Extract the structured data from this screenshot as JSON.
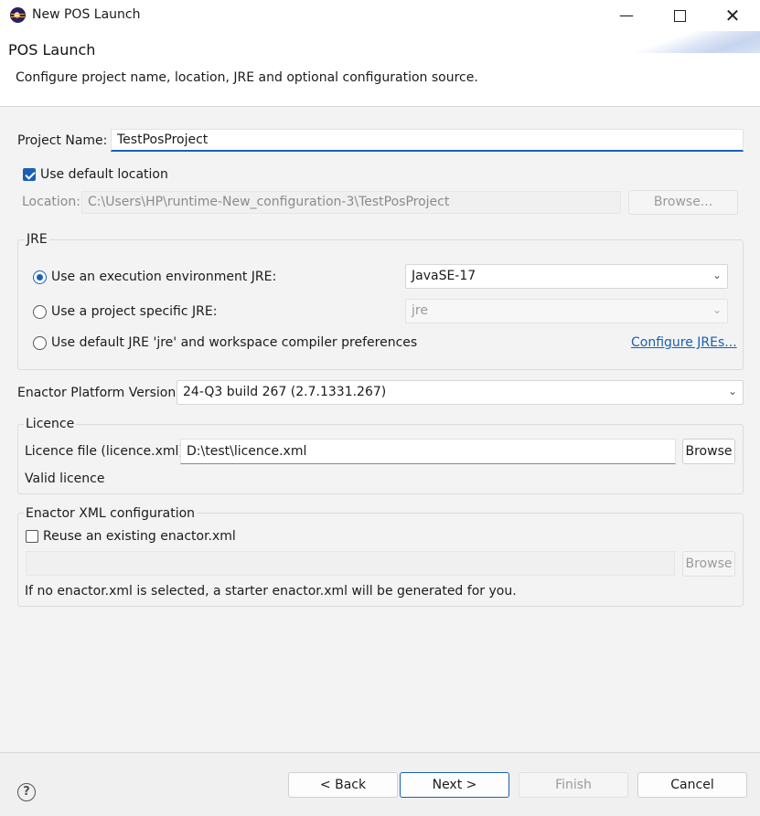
{
  "window": {
    "title": "New POS Launch",
    "minimize_icon": "minimize-icon",
    "maximize_icon": "maximize-icon",
    "close_icon": "close-icon"
  },
  "header": {
    "title": "POS Launch",
    "description": "Configure project name, location, JRE and optional configuration source."
  },
  "project": {
    "name_label": "Project Name:",
    "name_value": "TestPosProject"
  },
  "location": {
    "use_default_label": "Use default location",
    "use_default_checked": true,
    "label": "Location:",
    "value": "C:\\Users\\HP\\runtime-New_configuration-3\\TestPosProject",
    "browse_label": "Browse..."
  },
  "jre": {
    "group_title": "JRE",
    "option_env_label": "Use an execution environment JRE:",
    "option_env_value": "JavaSE-17",
    "option_specific_label": "Use a project specific JRE:",
    "option_specific_value": "jre",
    "option_default_label": "Use default JRE 'jre' and workspace compiler preferences",
    "configure_link": "Configure JREs...",
    "selected": "env"
  },
  "platform": {
    "label": "Enactor Platform Version:",
    "value": "24-Q3 build 267 (2.7.1331.267)"
  },
  "licence": {
    "group_title": "Licence",
    "file_label": "Licence file (licence.xml):",
    "file_value": "D:\\test\\licence.xml",
    "browse_label": "Browse",
    "status": "Valid licence"
  },
  "xml_config": {
    "group_title": "Enactor XML configuration",
    "reuse_label": "Reuse an existing enactor.xml",
    "reuse_checked": false,
    "path_value": "",
    "browse_label": "Browse",
    "note": "If no enactor.xml is selected, a starter enactor.xml will be generated for you."
  },
  "footer": {
    "help_icon": "help-icon",
    "back_label": "< Back",
    "next_label": "Next >",
    "finish_label": "Finish",
    "cancel_label": "Cancel"
  },
  "colors": {
    "accent": "#1a5fb4",
    "background": "#f3f3f3"
  }
}
